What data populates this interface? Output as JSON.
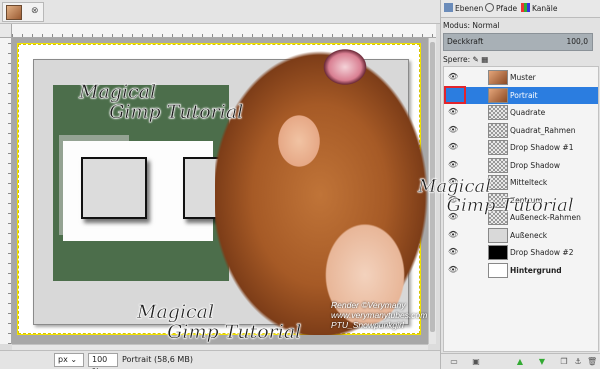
{
  "image_tab": {
    "close_glyph": "⊗"
  },
  "canvas": {
    "watermark_top": "Magical\n     Gimp Tutorial",
    "watermark_bottom": "Magical\n     Gimp Tutorial",
    "credit_lines": [
      "Render ©Verymany",
      "www.verymanytubes.com",
      "PTU_Snowpunkgirl"
    ]
  },
  "statusbar": {
    "unit": "px",
    "zoom": "100 %",
    "status_text": "Portrait (58,6 MB)"
  },
  "dock": {
    "tabs": [
      {
        "label": "Ebenen",
        "icon": "layers-icon"
      },
      {
        "label": "Pfade",
        "icon": "paths-icon"
      },
      {
        "label": "Kanäle",
        "icon": "channels-icon"
      }
    ],
    "mode_label": "Modus: Normal",
    "opacity_label": "Deckkraft",
    "opacity_value": "100,0",
    "lock_label": "Sperre:",
    "layers": [
      {
        "name": "Muster",
        "thumb": "photo",
        "selected": false,
        "bold": false
      },
      {
        "name": "Portrait",
        "thumb": "photo",
        "selected": true,
        "bold": false
      },
      {
        "name": "Quadrate",
        "thumb": "check",
        "selected": false,
        "bold": false
      },
      {
        "name": "Quadrat_Rahmen",
        "thumb": "check",
        "selected": false,
        "bold": false
      },
      {
        "name": "Drop Shadow #1",
        "thumb": "check",
        "selected": false,
        "bold": false
      },
      {
        "name": "Drop Shadow",
        "thumb": "check",
        "selected": false,
        "bold": false
      },
      {
        "name": "Mittelteck",
        "thumb": "check",
        "selected": false,
        "bold": false
      },
      {
        "name": "Zentrum",
        "thumb": "check",
        "selected": false,
        "bold": false
      },
      {
        "name": "Außeneck-Rahmen",
        "thumb": "check",
        "selected": false,
        "bold": false
      },
      {
        "name": "Außeneck",
        "thumb": "grey",
        "selected": false,
        "bold": false
      },
      {
        "name": "Drop Shadow #2",
        "thumb": "black",
        "selected": false,
        "bold": false
      },
      {
        "name": "Hintergrund",
        "thumb": "white",
        "selected": false,
        "bold": true
      }
    ],
    "watermark": "Magical\n     Gimp Tutorial"
  },
  "colors": {
    "selection": "#2b7de0",
    "highlight_box": "#e2242c",
    "frame_green": "#4c6e4b"
  }
}
